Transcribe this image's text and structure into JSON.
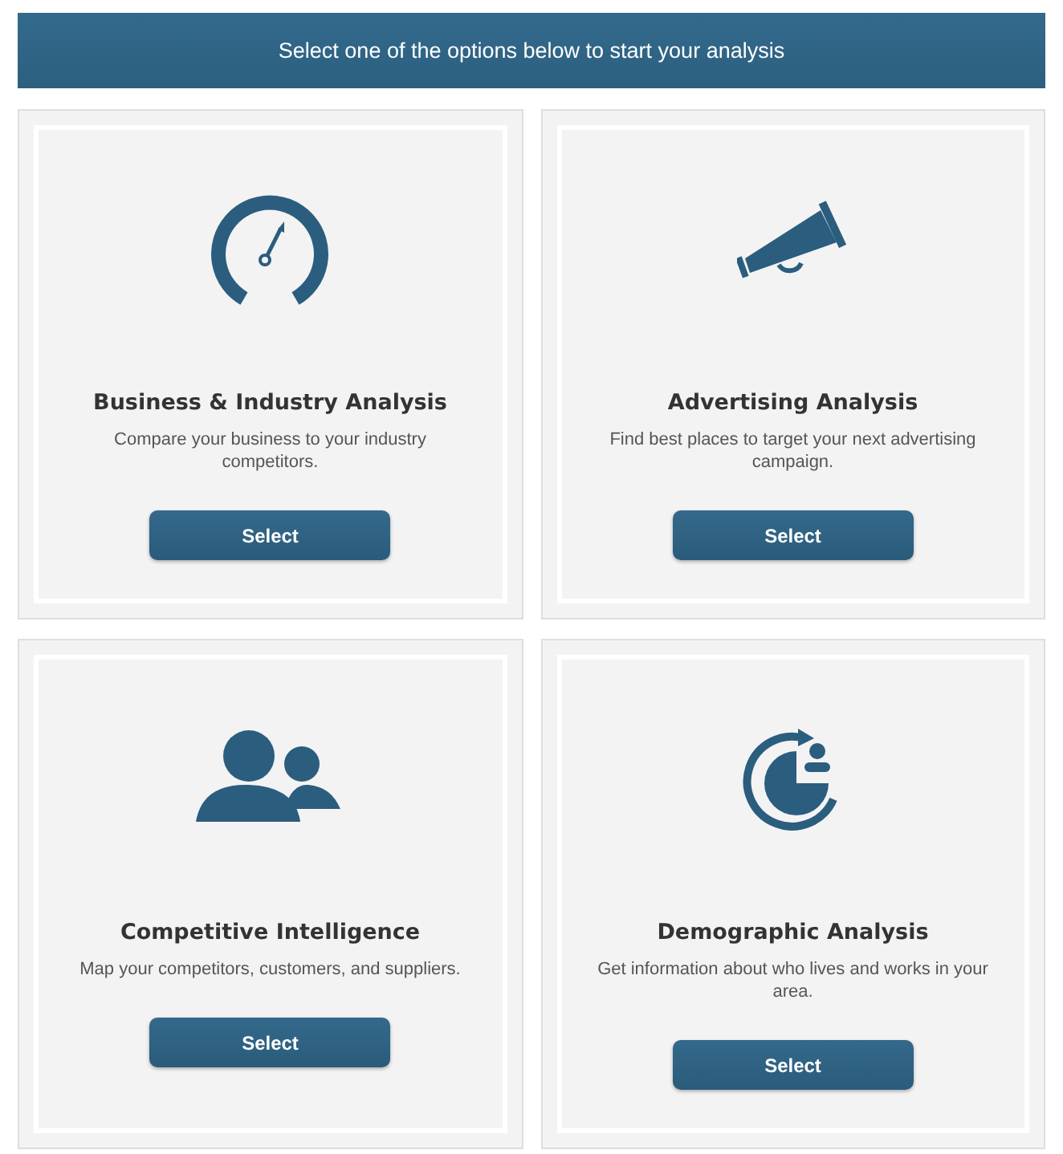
{
  "header": {
    "title": "Select one of the options below to start your analysis"
  },
  "options": [
    {
      "kind": "gauge",
      "title": "Business & Industry Analysis",
      "description": "Compare your business to your industry competitors.",
      "button": "Select"
    },
    {
      "kind": "megaphone",
      "title": "Advertising Analysis",
      "description": "Find best places to target your next advertising campaign.",
      "button": "Select"
    },
    {
      "kind": "people",
      "title": "Competitive Intelligence",
      "description": "Map your competitors, customers, and suppliers.",
      "button": "Select"
    },
    {
      "kind": "demographic",
      "title": "Demographic Analysis",
      "description": "Get information about who lives and works in your area.",
      "button": "Select"
    }
  ]
}
